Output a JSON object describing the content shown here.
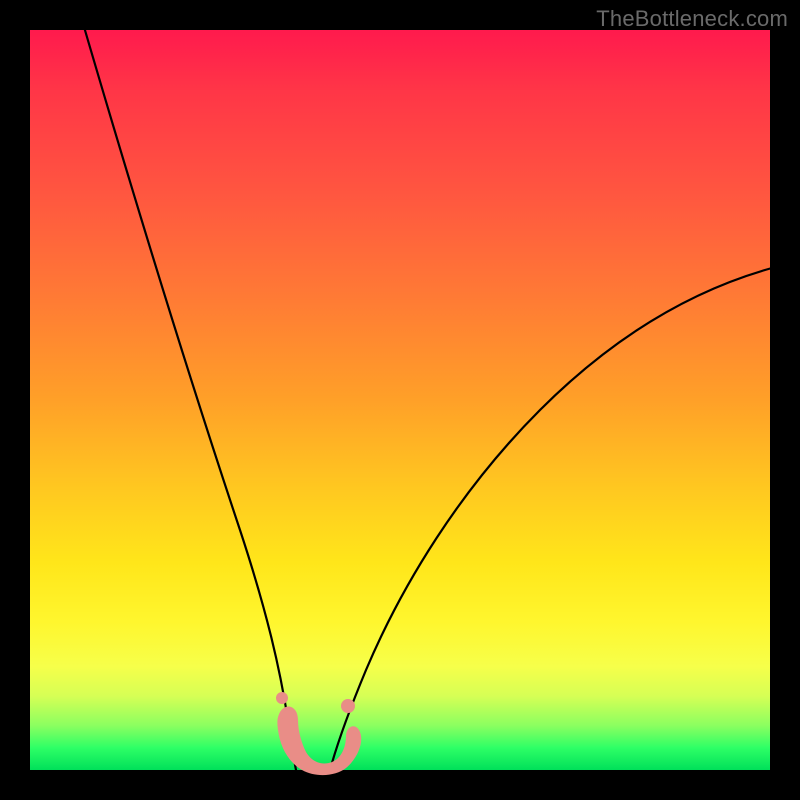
{
  "watermark": "TheBottleneck.com",
  "colors": {
    "background": "#000000",
    "gradient_top": "#ff1a4d",
    "gradient_mid": "#ffe61a",
    "gradient_bottom": "#00e05a",
    "curve": "#000000",
    "marker": "#e98d87"
  },
  "chart_data": {
    "type": "line",
    "title": "",
    "xlabel": "",
    "ylabel": "",
    "xlim": [
      0,
      100
    ],
    "ylim": [
      0,
      100
    ],
    "note": "No axis ticks or numeric labels are visible; values are estimated relative positions (0–100) of the plotted curves and markers.",
    "series": [
      {
        "name": "left-curve",
        "x": [
          7,
          10,
          14,
          18,
          22,
          26,
          28,
          30,
          32,
          33,
          34,
          35
        ],
        "y": [
          100,
          85,
          68,
          51,
          36,
          22,
          15,
          9,
          5,
          3,
          1,
          0
        ]
      },
      {
        "name": "right-curve",
        "x": [
          40,
          42,
          45,
          49,
          55,
          63,
          72,
          82,
          92,
          100
        ],
        "y": [
          0,
          3,
          8,
          15,
          25,
          36,
          47,
          56,
          63,
          68
        ]
      },
      {
        "name": "valley-markers",
        "x": [
          32.5,
          33.5,
          34.5,
          36,
          38,
          40,
          41.5,
          42.5
        ],
        "y": [
          6,
          4,
          2,
          0.5,
          0.5,
          1.5,
          4,
          7
        ]
      }
    ]
  }
}
